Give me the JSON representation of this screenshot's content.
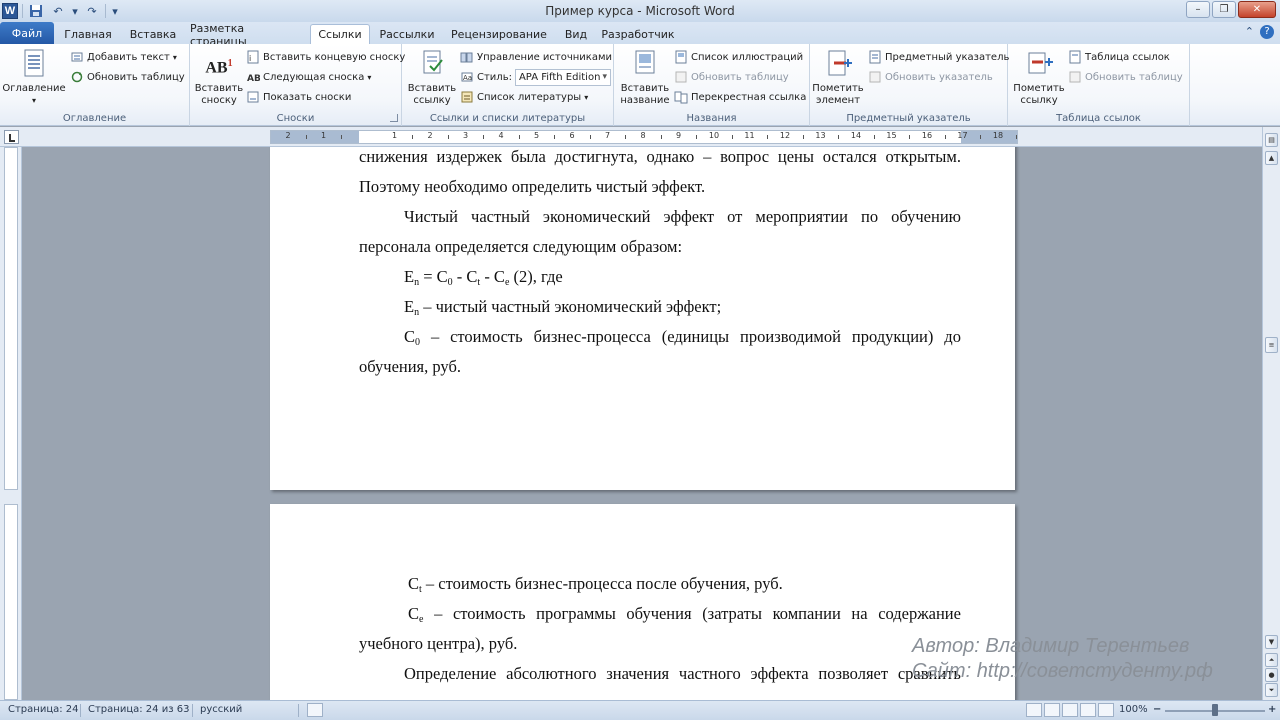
{
  "window": {
    "title": "Пример курса - Microsoft Word",
    "app_letter": "W"
  },
  "tabs": [
    "Файл",
    "Главная",
    "Вставка",
    "Разметка страницы",
    "Ссылки",
    "Рассылки",
    "Рецензирование",
    "Вид",
    "Разработчик"
  ],
  "active_tab": "Ссылки",
  "ribbon": {
    "toc": {
      "btn": "Оглавление",
      "add_text": "Добавить текст",
      "update_table": "Обновить таблицу",
      "label": "Оглавление"
    },
    "footnotes": {
      "insert_footnote_1": "Вставить",
      "insert_footnote_2": "сноску",
      "insert_endnote": "Вставить концевую сноску",
      "next_footnote": "Следующая сноска",
      "show_notes": "Показать сноски",
      "label": "Сноски"
    },
    "citations": {
      "insert_citation_1": "Вставить",
      "insert_citation_2": "ссылку",
      "manage_sources": "Управление источниками",
      "style_label": "Стиль:",
      "style_value": "APA Fifth Edition",
      "bibliography": "Список литературы",
      "label": "Ссылки и списки литературы"
    },
    "captions": {
      "insert_caption_1": "Вставить",
      "insert_caption_2": "название",
      "table_of_figures": "Список иллюстраций",
      "update_table": "Обновить таблицу",
      "cross_reference": "Перекрестная ссылка",
      "label": "Названия"
    },
    "index": {
      "mark_entry_1": "Пометить",
      "mark_entry_2": "элемент",
      "insert_index": "Предметный указатель",
      "update_index": "Обновить указатель",
      "label": "Предметный указатель"
    },
    "authorities": {
      "mark_citation_1": "Пометить",
      "mark_citation_2": "ссылку",
      "insert_table": "Таблица ссылок",
      "update_table": "Обновить таблицу",
      "label": "Таблица ссылок"
    }
  },
  "ruler_numbers": [
    "2",
    "1",
    "1",
    "2",
    "3",
    "4",
    "5",
    "6",
    "7",
    "8",
    "9",
    "10",
    "11",
    "12",
    "13",
    "14",
    "15",
    "16",
    "17",
    "18"
  ],
  "page1": {
    "l1": [
      "снижения",
      "издержек",
      "была",
      "достигнута,",
      "однако",
      "–",
      "вопрос",
      "цены",
      "остался",
      "открытым."
    ],
    "l2": "Поэтому необходимо определить чистый эффект.",
    "l3": [
      "Чистый",
      "частный",
      "экономический",
      "эффект",
      "от",
      "мероприятии",
      "по",
      "обучению"
    ],
    "l4": "персонала определяется следующим образом:",
    "formula": {
      "E": "E",
      "n": "n",
      "eq": " = C",
      "s0": "0",
      "m1": " - C",
      "st": "t",
      "m2": " - C",
      "se": "e",
      "tail": " (2), где"
    },
    "l6": {
      "E": "E",
      "n": "n",
      "text": " – чистый частный экономический эффект;"
    },
    "l7": {
      "C": "C",
      "sub": "0",
      "words": [
        "–",
        "стоимость",
        "бизнес-процесса",
        "(единицы",
        "производимой",
        "продукции)",
        "до"
      ]
    },
    "l8": "обучения, руб."
  },
  "page2": {
    "l1": {
      "C": "C",
      "sub": "t",
      "text": " – стоимость бизнес-процесса после обучения, руб."
    },
    "l2": {
      "C": "C",
      "sub": "e",
      "words": [
        "–",
        "стоимость",
        "программы",
        "обучения",
        "(затраты",
        "компании",
        "на",
        "содержание"
      ]
    },
    "l3": "учебного центра), руб.",
    "l4": [
      "Определение",
      "абсолютного",
      "значения",
      "частного",
      "эффекта",
      "позволяет",
      "сравнить"
    ]
  },
  "watermark": {
    "author": "Автор: Владимир Терентьев",
    "site": "Сайт: http://советстуденту.рф"
  },
  "status": {
    "page": "Страница: 24",
    "pages": "Страница: 24 из 63",
    "lang": "русский",
    "zoom": "100%"
  }
}
